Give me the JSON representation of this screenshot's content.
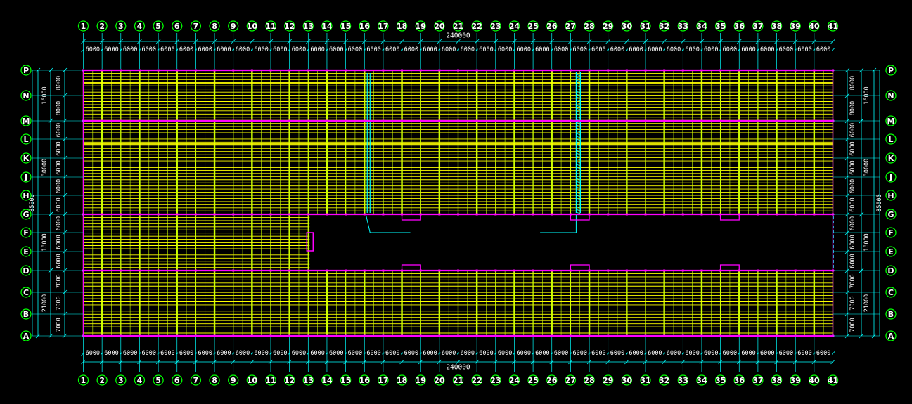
{
  "drawing": {
    "background_color": "#000000",
    "colors": {
      "bubble": "#00ff00",
      "dimension_line": "#00ffff",
      "purlin": "#ffff00",
      "rafter": "#ccff00",
      "main_beam": "#ff00ff",
      "bracing": "#00ffff",
      "text": "#ffffff"
    },
    "column_axes": [
      "1",
      "2",
      "3",
      "4",
      "5",
      "6",
      "7",
      "8",
      "9",
      "10",
      "11",
      "12",
      "13",
      "14",
      "15",
      "16",
      "17",
      "18",
      "19",
      "20",
      "21",
      "22",
      "23",
      "24",
      "25",
      "26",
      "27",
      "28",
      "29",
      "30",
      "31",
      "32",
      "33",
      "34",
      "35",
      "36",
      "37",
      "38",
      "39",
      "40",
      "41"
    ],
    "column_spacing_labels": [
      "6000",
      "6000",
      "6000",
      "6000",
      "6000",
      "6000",
      "6000",
      "6000",
      "6000",
      "6000",
      "6000",
      "6000",
      "6000",
      "6000",
      "6000",
      "6000",
      "6000",
      "6000",
      "6000",
      "6000",
      "6000",
      "6000",
      "6000",
      "6000",
      "6000",
      "6000",
      "6000",
      "6000",
      "6000",
      "6000",
      "6000",
      "6000",
      "6000",
      "6000",
      "6000",
      "6000",
      "6000",
      "6000",
      "6000",
      "6000"
    ],
    "column_total_top": "240000",
    "column_total_bottom": "240000",
    "row_axes": [
      "P",
      "N",
      "M",
      "L",
      "K",
      "J",
      "H",
      "G",
      "F",
      "E",
      "D",
      "C",
      "B",
      "A"
    ],
    "row_spacing_labels": [
      "8000",
      "8000",
      "6000",
      "6000",
      "6000",
      "6000",
      "6000",
      "6000",
      "6000",
      "6000",
      "7000",
      "7000",
      "7000"
    ],
    "row_groups": [
      {
        "label": "16000"
      },
      {
        "label": "30000"
      },
      {
        "label": "18000"
      },
      {
        "label": "21000"
      }
    ],
    "row_total": "85000"
  }
}
